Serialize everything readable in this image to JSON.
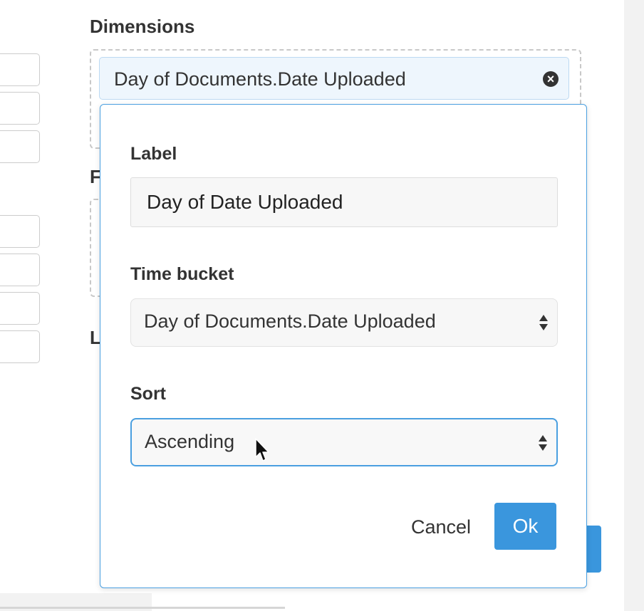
{
  "panel": {
    "dimensions_heading": "Dimensions",
    "hidden_heading_1_initial": "F",
    "hidden_heading_2_initial": "L"
  },
  "dimension_chip": {
    "label": "Day of Documents.Date Uploaded",
    "remove_icon": "circle-x-icon"
  },
  "popover": {
    "label_field": {
      "label": "Label",
      "value": "Day of Date Uploaded"
    },
    "time_bucket": {
      "label": "Time bucket",
      "selected": "Day of Documents.Date Uploaded",
      "icon": "chevron-updown-icon"
    },
    "sort": {
      "label": "Sort",
      "selected": "Ascending",
      "icon": "chevron-updown-icon"
    },
    "cancel_label": "Cancel",
    "ok_label": "Ok"
  },
  "colors": {
    "accent": "#3a96dd",
    "focus_border": "#4a9fe0",
    "chip_background": "#eef6fd"
  }
}
